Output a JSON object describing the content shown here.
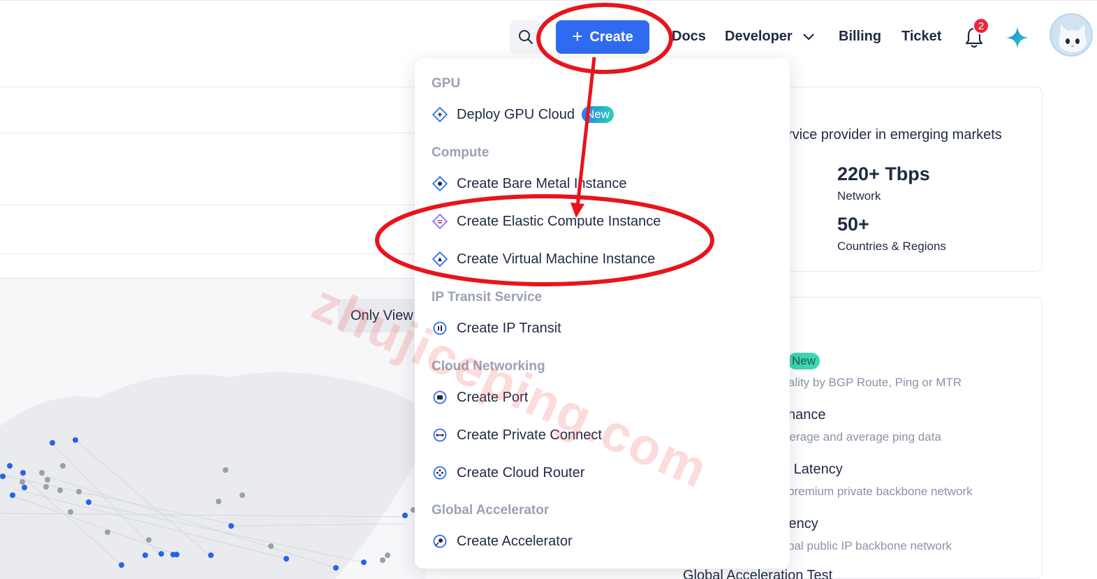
{
  "header": {
    "create_label": "Create",
    "nav": {
      "docs": "Docs",
      "developer": "Developer",
      "billing": "Billing",
      "ticket": "Ticket"
    },
    "notification_count": "2"
  },
  "dropdown": {
    "sections": {
      "gpu": "GPU",
      "compute": "Compute",
      "ip_transit": "IP Transit Service",
      "cloud_networking": "Cloud Networking",
      "global_accelerator": "Global Accelerator"
    },
    "items": {
      "deploy_gpu": "Deploy GPU Cloud",
      "deploy_gpu_badge": "New",
      "bare_metal": "Create Bare Metal Instance",
      "elastic_compute": "Create Elastic Compute Instance",
      "virtual_machine": "Create Virtual Machine Instance",
      "ip_transit": "Create IP Transit",
      "port": "Create Port",
      "private_connect": "Create Private Connect",
      "cloud_router": "Create Cloud Router",
      "accelerator": "Create Accelerator"
    }
  },
  "background": {
    "only_view": "Only View",
    "tagline": "rvice provider in emerging markets",
    "stats": [
      {
        "value": "220+ Tbps",
        "label": "Network"
      },
      {
        "value": "50+",
        "label": "Countries & Regions"
      }
    ],
    "features": [
      {
        "badge": "New",
        "desc": "quality by BGP Route, Ping or MTR"
      },
      {
        "title": "nance",
        "desc": "verage and average ping data"
      },
      {
        "title": "e Latency",
        "desc": "premium private backbone network"
      },
      {
        "title": "tency",
        "desc": "bal public IP backbone network"
      }
    ],
    "cut_text": "Global Acceleration Test"
  },
  "watermark": "zhujiceping.com",
  "colors": {
    "primary": "#2f6bf0",
    "badge_red": "#e8283c",
    "annotation_red": "#e8141c",
    "new_badge_start": "#2d7bf5",
    "new_badge_end": "#27d4b0"
  }
}
